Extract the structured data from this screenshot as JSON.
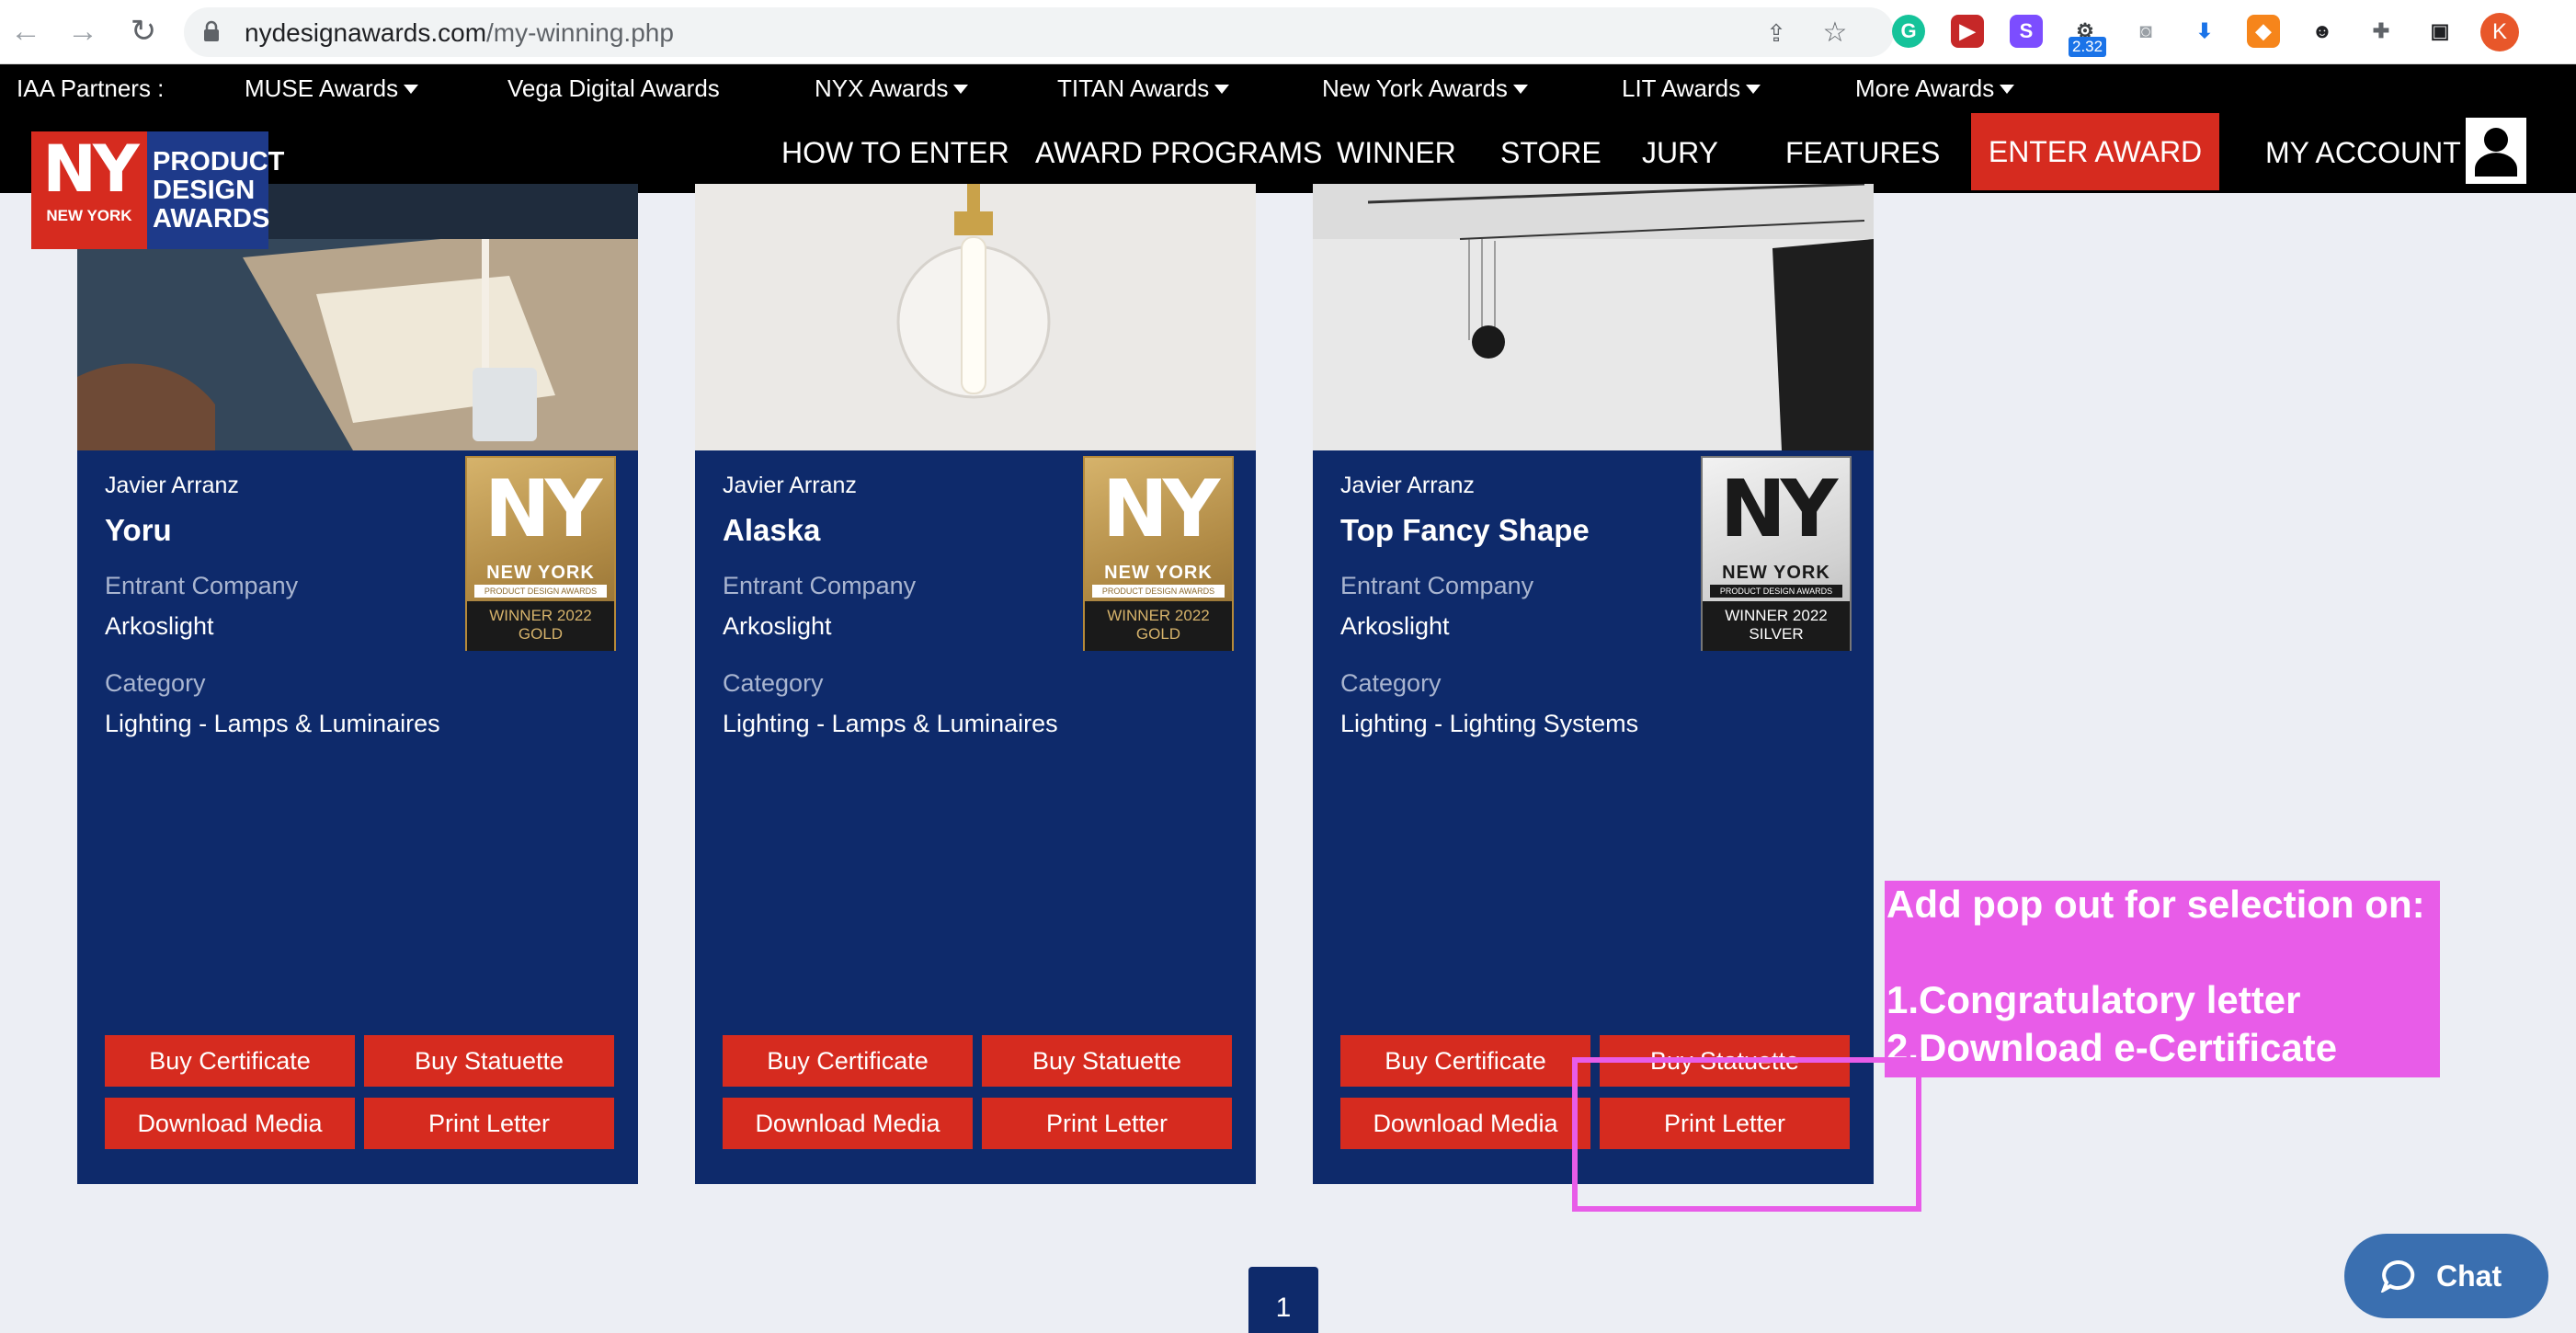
{
  "browser": {
    "url_host": "nydesignawards.com",
    "url_path": "/my-winning.php",
    "extension_badge": "2.32",
    "profile_initial": "K"
  },
  "partners_bar": {
    "label": "IAA Partners :",
    "items": [
      "MUSE Awards",
      "Vega Digital Awards",
      "NYX Awards",
      "TITAN Awards",
      "New York Awards",
      "LIT Awards",
      "More Awards"
    ]
  },
  "nav": {
    "items": [
      "HOW TO ENTER",
      "AWARD PROGRAMS",
      "WINNER",
      "STORE",
      "JURY",
      "FEATURES"
    ],
    "enter_award": "ENTER AWARD",
    "my_account": "MY ACCOUNT"
  },
  "logo": {
    "ny": "NY",
    "new_york": "NEW YORK",
    "line1": "PRODUCT",
    "line2": "DESIGN",
    "line3": "AWARDS"
  },
  "cards": [
    {
      "designer": "Javier Arranz",
      "title": "Yoru",
      "company_label": "Entrant Company",
      "company": "Arkoslight",
      "category_label": "Category",
      "category": "Lighting - Lamps & Luminaires",
      "badge": {
        "ny": "NY",
        "city": "NEW YORK",
        "program": "PRODUCT DESIGN AWARDS",
        "year": "WINNER 2022",
        "level": "GOLD"
      },
      "buttons": [
        "Buy Certificate",
        "Buy Statuette",
        "Download Media",
        "Print Letter"
      ]
    },
    {
      "designer": "Javier Arranz",
      "title": "Alaska",
      "company_label": "Entrant Company",
      "company": "Arkoslight",
      "category_label": "Category",
      "category": "Lighting - Lamps & Luminaires",
      "badge": {
        "ny": "NY",
        "city": "NEW YORK",
        "program": "PRODUCT DESIGN AWARDS",
        "year": "WINNER 2022",
        "level": "GOLD"
      },
      "buttons": [
        "Buy Certificate",
        "Buy Statuette",
        "Download Media",
        "Print Letter"
      ]
    },
    {
      "designer": "Javier Arranz",
      "title": "Top Fancy Shape",
      "company_label": "Entrant Company",
      "company": "Arkoslight",
      "category_label": "Category",
      "category": "Lighting - Lighting Systems",
      "badge": {
        "ny": "NY",
        "city": "NEW YORK",
        "program": "PRODUCT DESIGN AWARDS",
        "year": "WINNER 2022",
        "level": "SILVER"
      },
      "buttons": [
        "Buy Certificate",
        "Buy Statuette",
        "Download Media",
        "Print Letter"
      ]
    }
  ],
  "annotation": {
    "line1": "Add pop out for selection on:",
    "line2": "1.Congratulatory letter",
    "line3": "2.Download e-Certificate"
  },
  "pagination": {
    "current": "1"
  },
  "chat": {
    "label": "Chat"
  },
  "colors": {
    "brand_red": "#d62b1f",
    "card_navy": "#0e2a6b",
    "annotation_magenta": "#e85ce8",
    "chat_blue": "#3a6fb0"
  }
}
